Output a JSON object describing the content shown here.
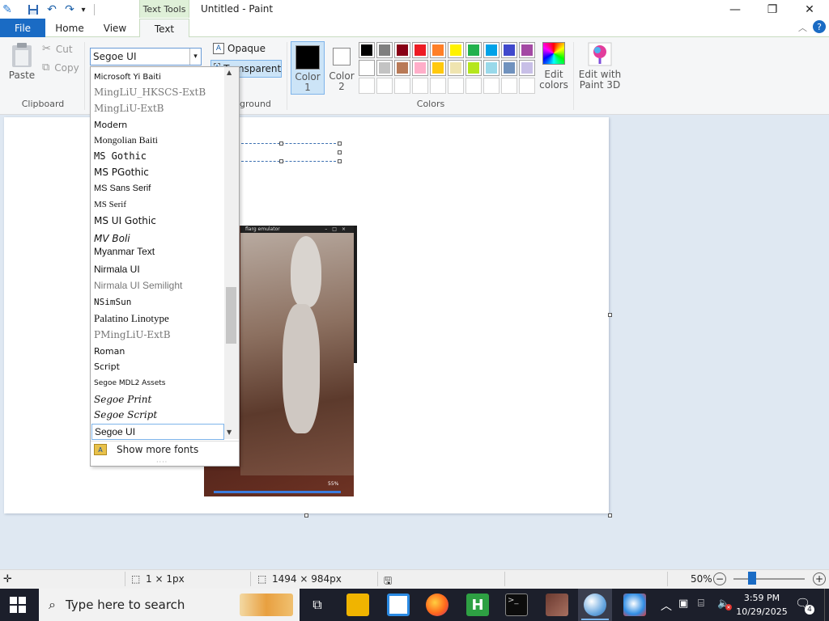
{
  "app": {
    "title": "Untitled - Paint",
    "context_tab": "Text Tools"
  },
  "window_controls": {
    "minimize_icon": "minimize-icon",
    "maximize_icon": "restore-icon",
    "close_icon": "close-icon"
  },
  "tabs": {
    "file": "File",
    "home": "Home",
    "view": "View",
    "text": "Text"
  },
  "clipboard": {
    "paste": "Paste",
    "cut": "Cut",
    "copy": "Copy",
    "label": "Clipboard"
  },
  "font": {
    "selected": "Segoe UI",
    "items": [
      {
        "name": "Microsoft Yi Baiti",
        "family": "\"DejaVu Sans\",sans-serif",
        "size": 10,
        "gray": false
      },
      {
        "name": "MingLiU_HKSCS-ExtB",
        "family": "\"DejaVu Serif\",serif",
        "size": 12,
        "gray": true
      },
      {
        "name": "MingLiU-ExtB",
        "family": "\"DejaVu Serif\",serif",
        "size": 12,
        "gray": true
      },
      {
        "name": "Modern",
        "family": "\"DejaVu Sans\",sans-serif",
        "size": 11,
        "gray": false
      },
      {
        "name": "Mongolian Baiti",
        "family": "\"Liberation Serif\",serif",
        "size": 12,
        "gray": false
      },
      {
        "name": "MS Gothic",
        "family": "\"DejaVu Sans Mono\",monospace",
        "size": 12,
        "gray": false
      },
      {
        "name": "MS PGothic",
        "family": "\"DejaVu Sans\",sans-serif",
        "size": 12,
        "gray": false
      },
      {
        "name": "MS Sans Serif",
        "family": "\"Liberation Sans\",sans-serif",
        "size": 11,
        "gray": false
      },
      {
        "name": "MS Serif",
        "family": "\"Liberation Serif\",serif",
        "size": 11,
        "gray": false
      },
      {
        "name": "MS UI Gothic",
        "family": "\"DejaVu Sans\",sans-serif",
        "size": 12,
        "gray": false
      },
      {
        "name": "MV Boli",
        "family": "\"DejaVu Sans\",sans-serif",
        "size": 12,
        "gray": false,
        "italic": true
      },
      {
        "name": "Myanmar Text",
        "family": "\"Liberation Sans\",sans-serif",
        "size": 12,
        "gray": false
      },
      {
        "name": "Nirmala UI",
        "family": "\"Liberation Sans\",sans-serif",
        "size": 12,
        "gray": false
      },
      {
        "name": "Nirmala UI Semilight",
        "family": "\"Liberation Sans\",sans-serif",
        "size": 12,
        "gray": true
      },
      {
        "name": "NSimSun",
        "family": "\"DejaVu Sans Mono\",monospace",
        "size": 11,
        "gray": false
      },
      {
        "name": "Palatino Linotype",
        "family": "\"Liberation Serif\",serif",
        "size": 13,
        "gray": false
      },
      {
        "name": "PMingLiU-ExtB",
        "family": "\"DejaVu Serif\",serif",
        "size": 12,
        "gray": true
      },
      {
        "name": "Roman",
        "family": "\"DejaVu Sans\",sans-serif",
        "size": 11,
        "gray": false
      },
      {
        "name": "Script",
        "family": "\"DejaVu Sans\",sans-serif",
        "size": 11,
        "gray": false
      },
      {
        "name": "Segoe MDL2 Assets",
        "family": "\"DejaVu Sans\",sans-serif",
        "size": 9,
        "gray": false
      },
      {
        "name": "Segoe Print",
        "family": "\"DejaVu Serif\",serif",
        "size": 12,
        "gray": false,
        "italic": true
      },
      {
        "name": "Segoe Script",
        "family": "\"DejaVu Serif\",serif",
        "size": 12,
        "gray": false,
        "italic": true
      },
      {
        "name": "Segoe UI",
        "family": "\"Liberation Sans\",sans-serif",
        "size": 12,
        "gray": false,
        "selected": true
      }
    ],
    "more_fonts": "Show more fonts"
  },
  "background": {
    "opaque": "Opaque",
    "transparent": "Transparent",
    "label": "Background",
    "label_visible": "ground"
  },
  "colors": {
    "color1_label": "Color 1",
    "color2_label": "Color 2",
    "color1": "#000000",
    "color2": "#ffffff",
    "label": "Colors",
    "edit_colors": "Edit colors",
    "edit_paint3d": "Edit with Paint 3D",
    "palette_row1": [
      "#000000",
      "#7f7f7f",
      "#880015",
      "#ed1c24",
      "#ff7f27",
      "#fff200",
      "#22b14c",
      "#00a2e8",
      "#3f48cc",
      "#a349a4"
    ],
    "palette_row2": [
      "#ffffff",
      "#c3c3c3",
      "#b97a57",
      "#ffaec9",
      "#ffc90e",
      "#efe4b0",
      "#b5e61d",
      "#99d9ea",
      "#7092be",
      "#c8bfe7"
    ]
  },
  "image": {
    "window_title": "flarg emulator",
    "progress_label": "55%"
  },
  "status": {
    "selection_size": "1 × 1px",
    "image_size": "1494 × 984px",
    "zoom": "50%"
  },
  "taskbar": {
    "search_placeholder": "Type here to search",
    "time": "3:59 PM",
    "date": "10/29/2025",
    "notifications": "4"
  }
}
